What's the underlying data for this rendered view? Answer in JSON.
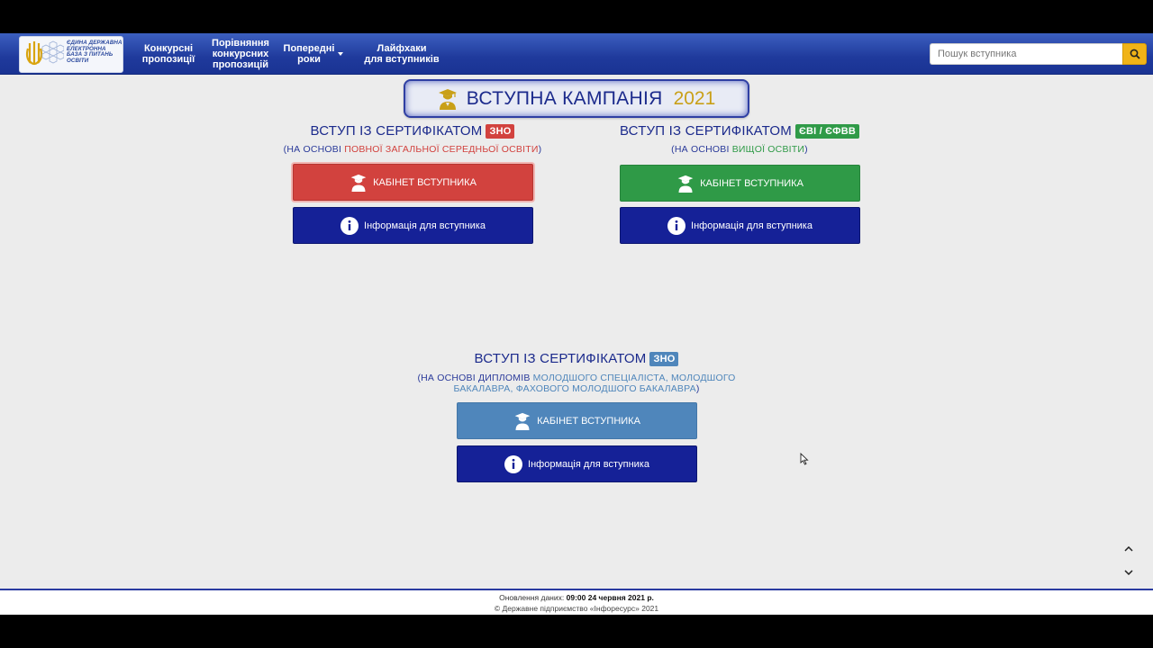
{
  "header": {
    "logo_text": "Єдина державна електронна база з питань освіти",
    "nav": [
      {
        "label": "Конкурсні\nпропозиції"
      },
      {
        "label": "Порівняння\nконкурсних\nпропозицій"
      },
      {
        "label": "Попередні\nроки"
      },
      {
        "label": "Лайфхаки\nдля вступників"
      }
    ],
    "search_placeholder": "Пошук вступника"
  },
  "campaign": {
    "title": "ВСТУПНА КАМПАНІЯ",
    "year": "2021"
  },
  "sections": {
    "zno": {
      "heading": "ВСТУП ІЗ СЕРТИФІКАТОМ",
      "badge": "ЗНО",
      "sub_prefix": "(НА ОСНОВІ ",
      "sub_highlight": "ПОВНОЇ ЗАГАЛЬНОЇ СЕРЕДНЬОЇ ОСВІТИ",
      "sub_suffix": ")",
      "cabinet_label": "КАБІНЕТ ВСТУПНИКА",
      "info_label": "Інформація для вступника"
    },
    "evi": {
      "heading": "ВСТУП ІЗ СЕРТИФІКАТОМ",
      "badge": "ЄВІ / ЄФВВ",
      "sub_prefix": "(НА ОСНОВІ ",
      "sub_highlight": "ВИЩОЇ ОСВІТИ",
      "sub_suffix": ")",
      "cabinet_label": "КАБІНЕТ ВСТУПНИКА",
      "info_label": "Інформація для вступника"
    },
    "junior": {
      "heading": "ВСТУП ІЗ СЕРТИФІКАТОМ",
      "badge": "ЗНО",
      "sub_prefix": "(НА ОСНОВІ ДИПЛОМІВ ",
      "sub_highlight": "МОЛОДШОГО СПЕЦІАЛІСТА, МОЛОДШОГО БАКАЛАВРА, ФАХОВОГО МОЛОДШОГО БАКАЛАВРА",
      "sub_suffix": ")",
      "cabinet_label": "КАБІНЕТ ВСТУПНИКА",
      "info_label": "Інформація для вступника"
    }
  },
  "footer": {
    "update_label": "Оновлення даних:",
    "update_value": "09:00 24 червня 2021 р.",
    "copyright": "© Державне підприємство «Інфоресурс» 2021"
  },
  "colors": {
    "navbar": "#1f3a9c",
    "zno_badge": "#d2423e",
    "evi_badge": "#2f9a47",
    "junior_badge": "#4f86bb",
    "info_button": "#152197",
    "accent_gold": "#c9a018"
  }
}
